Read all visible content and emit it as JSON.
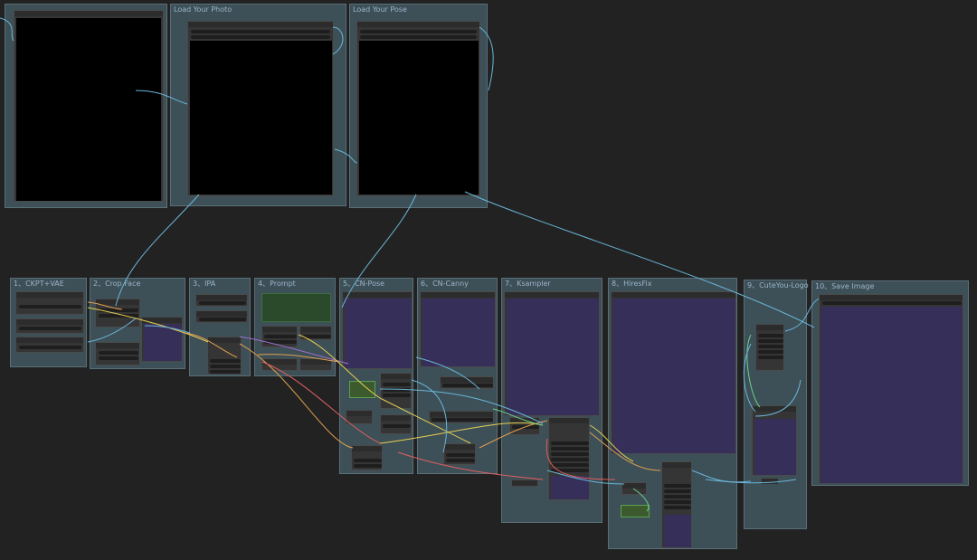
{
  "app": "ComfyUI workflow canvas",
  "groups": {
    "load_photo": "Load Your Photo",
    "load_pose": "Load Your Pose",
    "g1": "1、CKPT+VAE",
    "g2": "2、Crop Face",
    "g3": "3、IPA",
    "g4": "4、Prompt",
    "g5": "5、CN-Pose",
    "g6": "6、CN-Canny",
    "g7": "7、Ksampler",
    "g8": "8、HiresFix",
    "g9": "9、CuteYou-Logo",
    "g10": "10、Save Image"
  },
  "colors": {
    "canvas": "#222222",
    "group_bg": "#3d4f57",
    "group_title": "#9ab6c8",
    "preview_bg": "#362f5a",
    "wire_blue": "#6ab6d8",
    "wire_orange": "#e0a050",
    "wire_yellow": "#e6d050",
    "wire_red": "#e06060",
    "wire_green": "#6ad08a",
    "wire_purple": "#a070d0"
  }
}
